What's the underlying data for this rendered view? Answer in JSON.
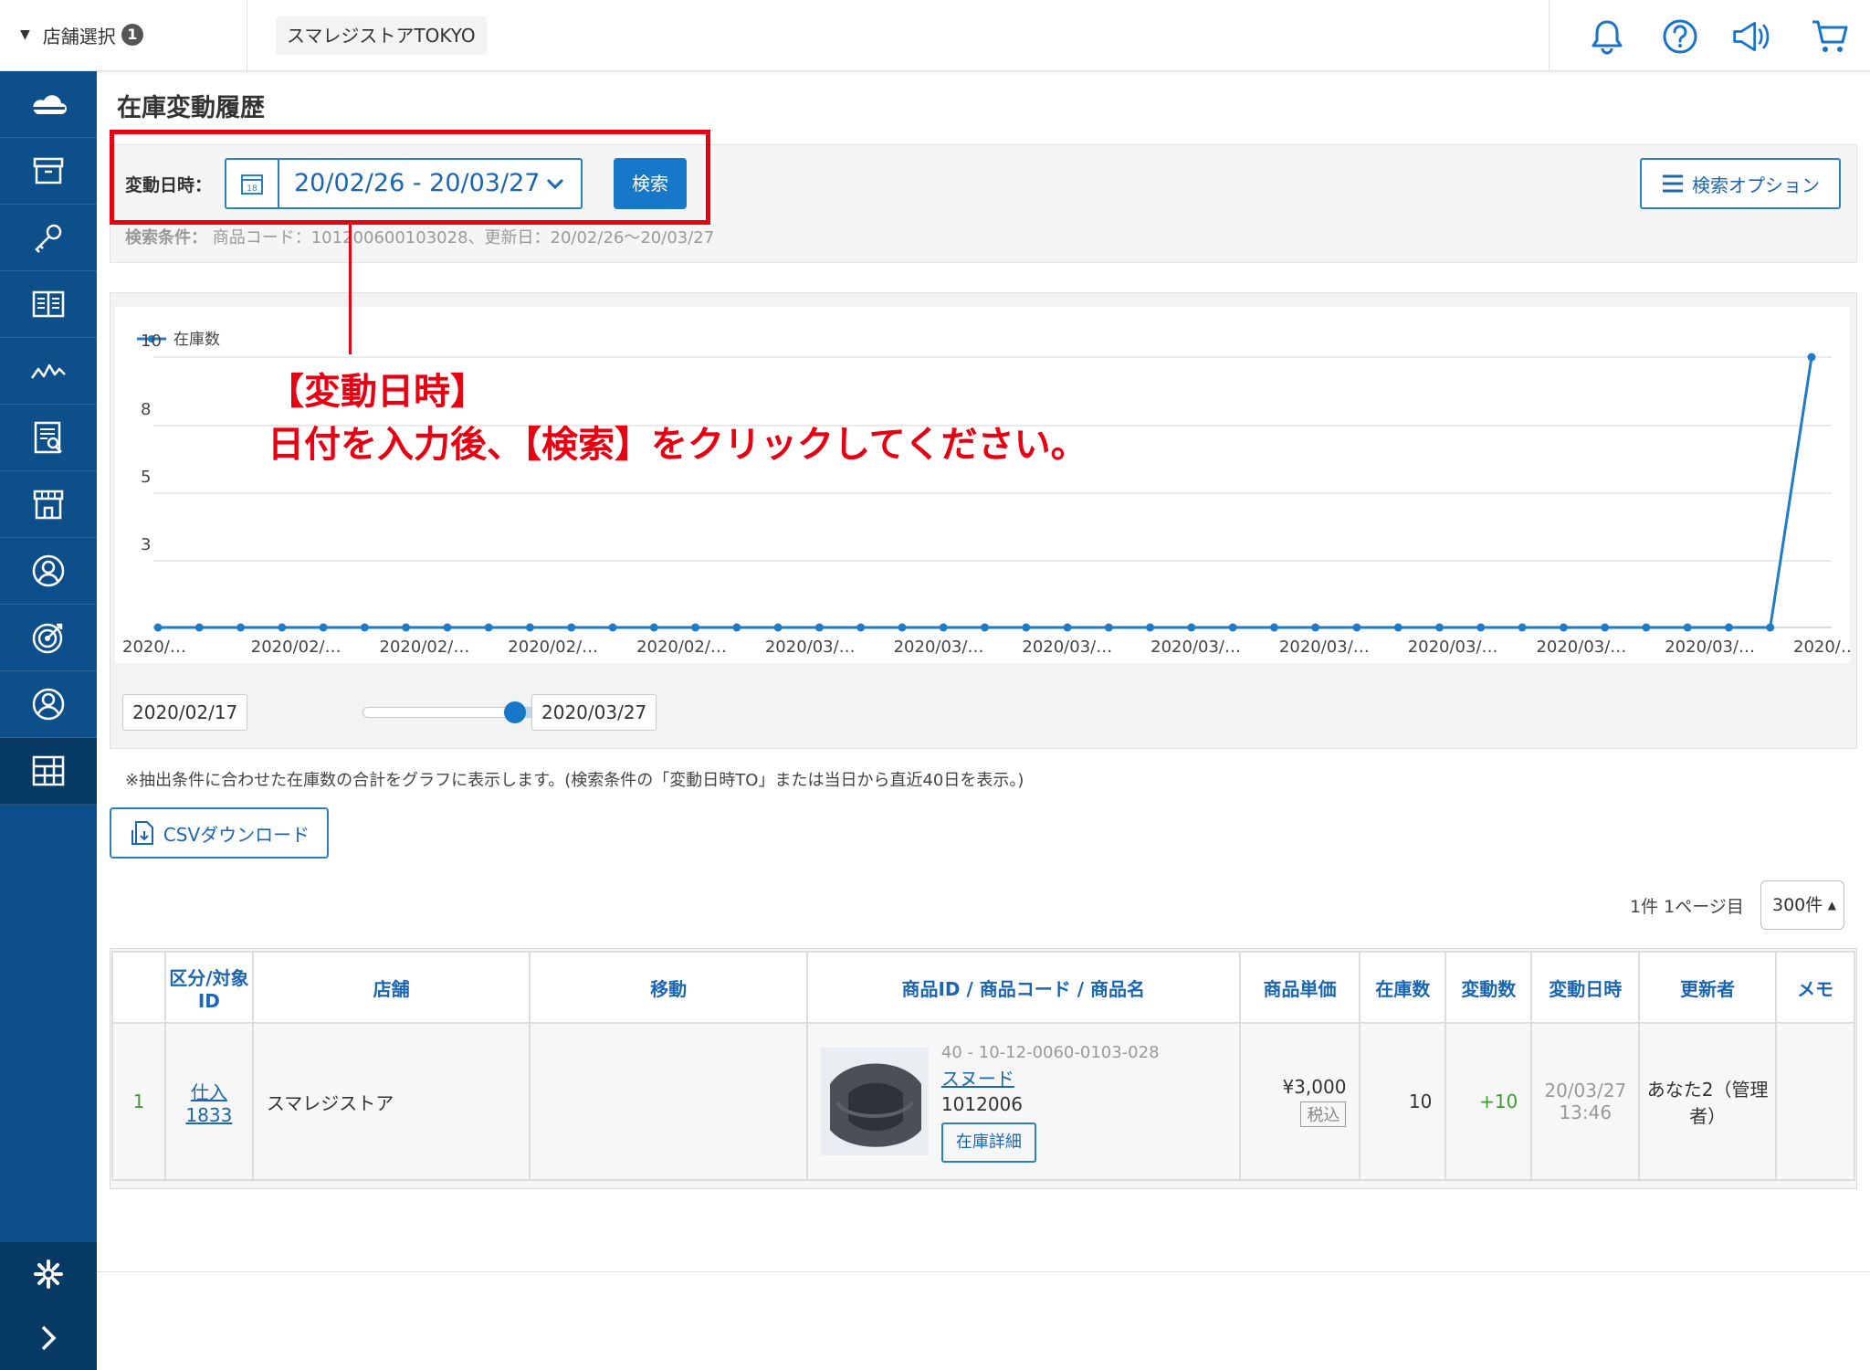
{
  "header": {
    "store_select_label": "店舗選択",
    "store_select_count": "1",
    "store_name": "スマレジストアTOKYO",
    "icons": [
      "bell-icon",
      "help-icon",
      "megaphone-icon",
      "cart-icon"
    ]
  },
  "sidebar": {
    "items": [
      "cloud-icon",
      "archive-icon",
      "key-icon",
      "book-icon",
      "chart-line-icon",
      "report-icon",
      "store-icon",
      "customer-icon",
      "target-icon",
      "user-icon",
      "grid-icon"
    ],
    "active_index": 10,
    "bottom": [
      "gear-icon",
      "chevron-right-icon"
    ]
  },
  "page": {
    "title": "在庫変動履歴",
    "date_label": "変動日時：",
    "date_value": "20/02/26 - 20/03/27",
    "search_button": "検索",
    "options_button": "検索オプション",
    "condition_label": "検索条件：",
    "condition_text": "商品コード：101200600103028、更新日：20/02/26～20/03/27"
  },
  "annotation": {
    "line1": "【変動日時】",
    "line2": "日付を入力後、【検索】をクリックしてください。"
  },
  "chart_data": {
    "type": "line",
    "legend": "在庫数",
    "yticks": [
      "10",
      "8",
      "5",
      "3"
    ],
    "ylim": [
      0,
      10
    ],
    "xticks": [
      "2020/…",
      "2020/02/…",
      "2020/02/…",
      "2020/02/…",
      "2020/02/…",
      "2020/03/…",
      "2020/03/…",
      "2020/03/…",
      "2020/03/…",
      "2020/03/…",
      "2020/03/…",
      "2020/03/…",
      "2020/03/…",
      "2020/…"
    ],
    "values": [
      0,
      0,
      0,
      0,
      0,
      0,
      0,
      0,
      0,
      0,
      0,
      0,
      0,
      0,
      0,
      0,
      0,
      0,
      0,
      0,
      0,
      0,
      0,
      0,
      0,
      0,
      0,
      0,
      0,
      0,
      0,
      0,
      0,
      0,
      0,
      0,
      0,
      0,
      0,
      0,
      10
    ],
    "color": "#1f7ac7"
  },
  "range": {
    "from": "2020/02/17",
    "to": "2020/03/27"
  },
  "note": "※抽出条件に合わせた在庫数の合計をグラフに表示します。(検索条件の「変動日時TO」または当日から直近40日を表示。)",
  "csv_button": "CSVダウンロード",
  "pagination": {
    "info": "1件 1ページ目",
    "per_page": "300件"
  },
  "table": {
    "headers": [
      "",
      "区分/対象ID",
      "店舗",
      "移動",
      "商品ID / 商品コード / 商品名",
      "商品単価",
      "在庫数",
      "変動数",
      "変動日時",
      "更新者",
      "メモ"
    ],
    "rows": [
      {
        "no": "1",
        "kind": "仕入",
        "target_id": "1833",
        "store": "スマレジストア",
        "move": "",
        "product_code": "40 - 10-12-0060-0103-028",
        "product_name": "スヌード",
        "product_sub": "1012006",
        "stock_detail_button": "在庫詳細",
        "price": "¥3,000",
        "tax": "税込",
        "stock": "10",
        "change": "+10",
        "date": "20/03/27",
        "time": "13:46",
        "updater": "あなた2（管理者）",
        "memo": ""
      }
    ]
  }
}
